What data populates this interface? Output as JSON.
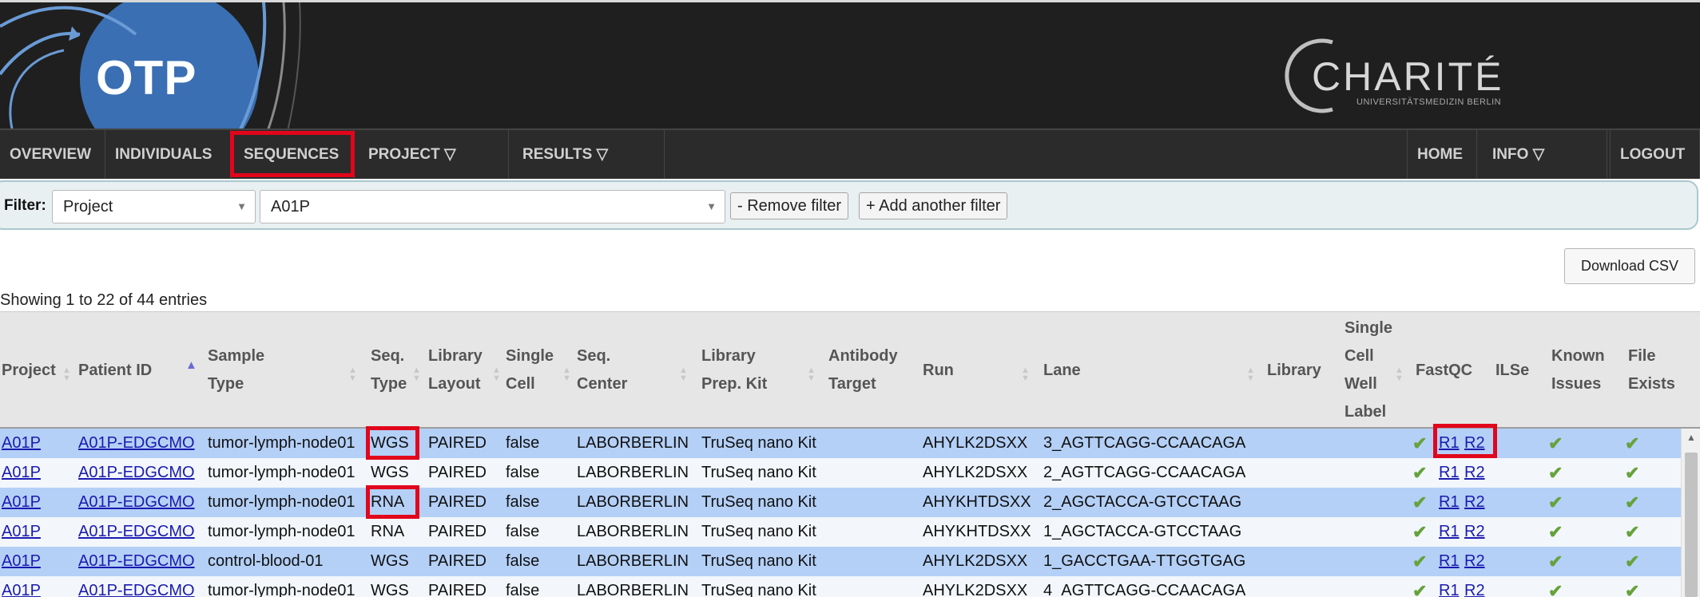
{
  "header": {
    "logo_text": "OTP",
    "partner_logo": "CHARITÉ",
    "partner_subtitle": "UNIVERSITÄTSMEDIZIN BERLIN"
  },
  "nav": {
    "left": [
      {
        "label": "OVERVIEW"
      },
      {
        "label": "INDIVIDUALS"
      },
      {
        "label": "SEQUENCES"
      },
      {
        "label": "PROJECT ▽"
      },
      {
        "label": "RESULTS ▽"
      }
    ],
    "right": [
      {
        "label": "HOME"
      },
      {
        "label": "INFO ▽"
      },
      {
        "label": "LOGOUT"
      }
    ],
    "active": "SEQUENCES"
  },
  "filter": {
    "label": "Filter:",
    "field_value": "Project",
    "value_value": "A01P",
    "remove_label": "- Remove filter",
    "add_label": "+ Add another filter"
  },
  "download_csv": "Download CSV",
  "showing": "Showing 1 to 22 of 44 entries",
  "table": {
    "columns": {
      "project": "Project",
      "patient_id": "Patient ID",
      "sample_type_1": "Sample",
      "sample_type_2": "Type",
      "seq_type_1": "Seq.",
      "seq_type_2": "Type",
      "library_layout_1": "Library",
      "library_layout_2": "Layout",
      "single_cell_1": "Single",
      "single_cell_2": "Cell",
      "seq_center_1": "Seq.",
      "seq_center_2": "Center",
      "library_prep_1": "Library",
      "library_prep_2": "Prep. Kit",
      "antibody_1": "Antibody",
      "antibody_2": "Target",
      "run": "Run",
      "lane": "Lane",
      "library": "Library",
      "sc_well_1": "Single",
      "sc_well_2": "Cell",
      "sc_well_3": "Well",
      "sc_well_4": "Label",
      "fastqc": "FastQC",
      "ilse": "ILSe",
      "known_issues_1": "Known",
      "known_issues_2": "Issues",
      "file_exists_1": "File",
      "file_exists_2": "Exists"
    },
    "rows": [
      {
        "project": "A01P",
        "patient_id": "A01P-EDGCMO",
        "sample_type": "tumor-lymph-node01",
        "seq_type": "WGS",
        "layout": "PAIRED",
        "single_cell": "false",
        "center": "LABORBERLIN",
        "prep_kit": "TruSeq nano Kit",
        "run": "AHYLK2DSXX",
        "lane": "3_AGTTCAGG-CCAACAGA",
        "r1": "R1",
        "r2": "R2"
      },
      {
        "project": "A01P",
        "patient_id": "A01P-EDGCMO",
        "sample_type": "tumor-lymph-node01",
        "seq_type": "WGS",
        "layout": "PAIRED",
        "single_cell": "false",
        "center": "LABORBERLIN",
        "prep_kit": "TruSeq nano Kit",
        "run": "AHYLK2DSXX",
        "lane": "2_AGTTCAGG-CCAACAGA",
        "r1": "R1",
        "r2": "R2"
      },
      {
        "project": "A01P",
        "patient_id": "A01P-EDGCMO",
        "sample_type": "tumor-lymph-node01",
        "seq_type": "RNA",
        "layout": "PAIRED",
        "single_cell": "false",
        "center": "LABORBERLIN",
        "prep_kit": "TruSeq nano Kit",
        "run": "AHYKHTDSXX",
        "lane": "2_AGCTACCA-GTCCTAAG",
        "r1": "R1",
        "r2": "R2"
      },
      {
        "project": "A01P",
        "patient_id": "A01P-EDGCMO",
        "sample_type": "tumor-lymph-node01",
        "seq_type": "RNA",
        "layout": "PAIRED",
        "single_cell": "false",
        "center": "LABORBERLIN",
        "prep_kit": "TruSeq nano Kit",
        "run": "AHYKHTDSXX",
        "lane": "1_AGCTACCA-GTCCTAAG",
        "r1": "R1",
        "r2": "R2"
      },
      {
        "project": "A01P",
        "patient_id": "A01P-EDGCMO",
        "sample_type": "control-blood-01",
        "seq_type": "WGS",
        "layout": "PAIRED",
        "single_cell": "false",
        "center": "LABORBERLIN",
        "prep_kit": "TruSeq nano Kit",
        "run": "AHYLK2DSXX",
        "lane": "1_GACCTGAA-TTGGTGAG",
        "r1": "R1",
        "r2": "R2"
      },
      {
        "project": "A01P",
        "patient_id": "A01P-EDGCMO",
        "sample_type": "tumor-lymph-node01",
        "seq_type": "WGS",
        "layout": "PAIRED",
        "single_cell": "false",
        "center": "LABORBERLIN",
        "prep_kit": "TruSeq nano Kit",
        "run": "AHYLK2DSXX",
        "lane": "4_AGTTCAGG-CCAACAGA",
        "r1": "R1",
        "r2": "R2"
      }
    ]
  },
  "colors": {
    "highlight": "#e1061b",
    "row_odd": "#b4d0f7",
    "row_even": "#f3f7fb",
    "check": "#66a23b",
    "link": "#1a1ab0"
  }
}
